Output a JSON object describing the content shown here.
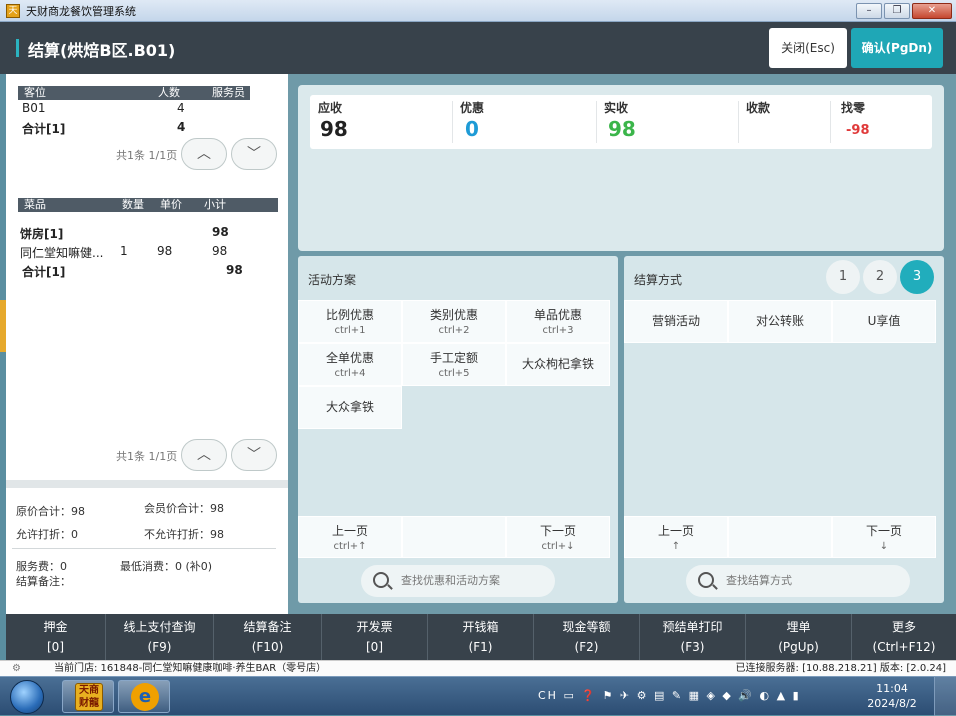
{
  "window": {
    "app_icon_text": "天",
    "title": "天财商龙餐饮管理系统",
    "minimize": "–",
    "maximize": "❐",
    "close": "✕"
  },
  "header": {
    "title": "结算(烘焙B区.B01)",
    "close_button": "关闭(Esc)",
    "confirm_button": "确认(PgDn)"
  },
  "guests": {
    "columns": [
      "客位",
      "人数",
      "服务员"
    ],
    "rows": [
      {
        "seat": "B01",
        "count": "4",
        "waiter": ""
      }
    ],
    "total_label": "合计[1]",
    "total_count": "4",
    "pager": "共1条 1/1页"
  },
  "dishes": {
    "columns": [
      "菜品",
      "数量",
      "单价",
      "小计"
    ],
    "group_label": "饼房[1]",
    "group_subtotal": "98",
    "rows": [
      {
        "name": "同仁堂知嘛健...",
        "qty": "1",
        "price": "98",
        "subtotal": "98"
      }
    ],
    "total_label": "合计[1]",
    "total_value": "98",
    "pager": "共1条 1/1页"
  },
  "summary": {
    "original_total": "原价合计：98",
    "member_total": "会员价合计：98",
    "discountable": "允许打折：0",
    "non_discountable": "不允许打折：98",
    "service_fee": "服务费：0",
    "min_spend": "最低消费：0 (补0)",
    "remark": "结算备注："
  },
  "amounts": {
    "receivable_label": "应收",
    "receivable": "98",
    "discount_label": "优惠",
    "discount": "0",
    "actual_label": "实收",
    "actual": "98",
    "collected_label": "收款",
    "collected": "",
    "change_label": "找零",
    "change": "-98",
    "colors": {
      "discount": "#1e9bd6",
      "actual": "#3bb54a",
      "change": "#e03a3a"
    }
  },
  "promotions": {
    "title": "活动方案",
    "items": [
      {
        "label": "比例优惠",
        "key": "ctrl+1"
      },
      {
        "label": "类别优惠",
        "key": "ctrl+2"
      },
      {
        "label": "单品优惠",
        "key": "ctrl+3"
      },
      {
        "label": "全单优惠",
        "key": "ctrl+4"
      },
      {
        "label": "手工定额",
        "key": "ctrl+5"
      },
      {
        "label": "大众枸杞拿铁",
        "key": ""
      },
      {
        "label": "大众拿铁",
        "key": ""
      }
    ],
    "prev_label": "上一页",
    "prev_key": "ctrl+↑",
    "next_label": "下一页",
    "next_key": "ctrl+↓",
    "search_placeholder": "查找优惠和活动方案"
  },
  "payment": {
    "title": "结算方式",
    "pages": [
      "1",
      "2",
      "3"
    ],
    "active_page": "3",
    "items": [
      "营销活动",
      "对公转账",
      "U享值"
    ],
    "prev_label": "上一页",
    "prev_key": "↑",
    "next_label": "下一页",
    "next_key": "↓",
    "search_placeholder": "查找结算方式"
  },
  "function_keys": [
    {
      "label": "押金",
      "key": "[0]"
    },
    {
      "label": "线上支付查询",
      "key": "(F9)"
    },
    {
      "label": "结算备注",
      "key": "(F10)"
    },
    {
      "label": "开发票",
      "key": "[0]"
    },
    {
      "label": "开钱箱",
      "key": "(F1)"
    },
    {
      "label": "现金等额",
      "key": "(F2)"
    },
    {
      "label": "预结单打印",
      "key": "(F3)"
    },
    {
      "label": "埋单",
      "key": "(PgUp)"
    },
    {
      "label": "更多",
      "key": "(Ctrl+F12)"
    }
  ],
  "status": {
    "store": "当前门店: 161848-同仁堂知嘛健康咖啡·养生BAR（零号店）",
    "server": "已连接服务器: [10.88.218.21] 版本: [2.0.24]"
  },
  "taskbar": {
    "app_name": "天商 财龍",
    "tray_text": "CH ▭ ❓ ⚑ ✈ ⚙ ▤ ✎ ▦ ◈ ◆ 🔊 ◐ ▲ ▮",
    "time": "11:04",
    "date": "2024/8/2"
  }
}
